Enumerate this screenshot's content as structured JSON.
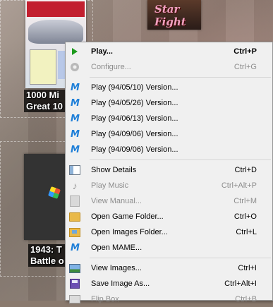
{
  "games": [
    {
      "title_line1": "1000 Mi",
      "title_line2": "Great 10"
    },
    {
      "title_line1": "1943: T",
      "title_line2": "Battle o"
    }
  ],
  "cover2_logo": "Star Fight",
  "menu": {
    "items": [
      {
        "label": "Play...",
        "shortcut": "Ctrl+P",
        "icon": "play-icon",
        "enabled": true,
        "bold": true
      },
      {
        "label": "Configure...",
        "shortcut": "Ctrl+G",
        "icon": "configure-icon",
        "enabled": false
      },
      {
        "label": "Play (94/05/10) Version...",
        "shortcut": "",
        "icon": "mame-icon",
        "enabled": true
      },
      {
        "label": "Play (94/05/26) Version...",
        "shortcut": "",
        "icon": "mame-icon",
        "enabled": true
      },
      {
        "label": "Play (94/06/13) Version...",
        "shortcut": "",
        "icon": "mame-icon",
        "enabled": true
      },
      {
        "label": "Play (94/09/06) Version...",
        "shortcut": "",
        "icon": "mame-icon",
        "enabled": true
      },
      {
        "label": "Play (94/09/06) Version...",
        "shortcut": "",
        "icon": "mame-icon",
        "enabled": true
      },
      {
        "label": "Show Details",
        "shortcut": "Ctrl+D",
        "icon": "details-icon",
        "enabled": true
      },
      {
        "label": "Play Music",
        "shortcut": "Ctrl+Alt+P",
        "icon": "music-note-icon",
        "enabled": false
      },
      {
        "label": "View Manual...",
        "shortcut": "Ctrl+M",
        "icon": "manual-icon",
        "enabled": false
      },
      {
        "label": "Open Game Folder...",
        "shortcut": "Ctrl+O",
        "icon": "folder-icon",
        "enabled": true
      },
      {
        "label": "Open Images Folder...",
        "shortcut": "Ctrl+L",
        "icon": "images-folder-icon",
        "enabled": true
      },
      {
        "label": "Open MAME...",
        "shortcut": "",
        "icon": "mame-icon",
        "enabled": true
      },
      {
        "label": "View Images...",
        "shortcut": "Ctrl+I",
        "icon": "view-images-icon",
        "enabled": true
      },
      {
        "label": "Save Image As...",
        "shortcut": "Ctrl+Alt+I",
        "icon": "save-icon",
        "enabled": true
      },
      {
        "label": "Flip Box",
        "shortcut": "Ctrl+B",
        "icon": "flip-box-icon",
        "enabled": false
      }
    ]
  },
  "colors": {
    "menu_bg": "#f0f0f0",
    "menu_border": "#979797",
    "disabled_text": "#8d8d8d",
    "play_green": "#1c9a1c",
    "mame_blue": "#1e7fd8"
  }
}
